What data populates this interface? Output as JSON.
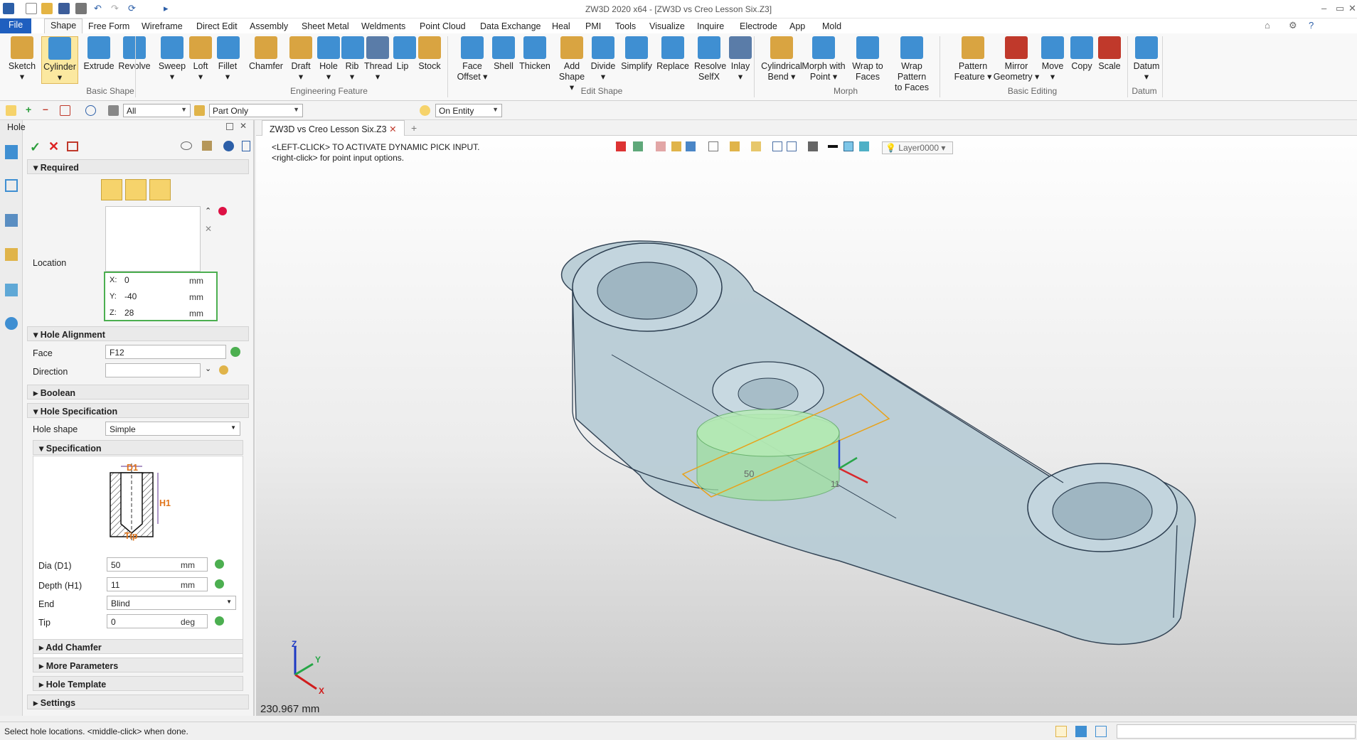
{
  "app": {
    "title": "ZW3D 2020 x64 - [ZW3D vs Creo Lesson Six.Z3]"
  },
  "menu": {
    "file": "File",
    "tabs": [
      "Shape",
      "Free Form",
      "Wireframe",
      "Direct Edit",
      "Assembly",
      "Sheet Metal",
      "Weldments",
      "Point Cloud",
      "Data Exchange",
      "Heal",
      "PMI",
      "Tools",
      "Visualize",
      "Inquire",
      "Electrode",
      "App",
      "Mold"
    ]
  },
  "ribbon": {
    "tools": [
      {
        "l1": "Sketch",
        "l2": "▾",
        "color": "#d9a441"
      },
      {
        "l1": "Cylinder",
        "l2": "▾",
        "color": "#3f8fd2"
      },
      {
        "l1": "Extrude",
        "l2": "",
        "color": "#3f8fd2"
      },
      {
        "l1": "Revolve",
        "l2": "",
        "color": "#3f8fd2"
      },
      {
        "l1": "Sweep",
        "l2": "▾",
        "color": "#3f8fd2"
      },
      {
        "l1": "Loft",
        "l2": "▾",
        "color": "#d9a441"
      },
      {
        "l1": "Fillet",
        "l2": "▾",
        "color": "#3f8fd2"
      },
      {
        "l1": "Chamfer",
        "l2": "",
        "color": "#d9a441"
      },
      {
        "l1": "Draft",
        "l2": "▾",
        "color": "#d9a441"
      },
      {
        "l1": "Hole",
        "l2": "▾",
        "color": "#3f8fd2"
      },
      {
        "l1": "Rib",
        "l2": "▾",
        "color": "#3f8fd2"
      },
      {
        "l1": "Thread",
        "l2": "▾",
        "color": "#5a7ca8"
      },
      {
        "l1": "Lip",
        "l2": "",
        "color": "#3f8fd2"
      },
      {
        "l1": "Stock",
        "l2": "",
        "color": "#d9a441"
      },
      {
        "l1": "Face",
        "l2": "Offset ▾",
        "color": "#3f8fd2"
      },
      {
        "l1": "Shell",
        "l2": "",
        "color": "#3f8fd2"
      },
      {
        "l1": "Thicken",
        "l2": "",
        "color": "#3f8fd2"
      },
      {
        "l1": "Add",
        "l2": "Shape ▾",
        "color": "#d9a441"
      },
      {
        "l1": "Divide",
        "l2": "▾",
        "color": "#3f8fd2"
      },
      {
        "l1": "Simplify",
        "l2": "",
        "color": "#3f8fd2"
      },
      {
        "l1": "Replace",
        "l2": "",
        "color": "#3f8fd2"
      },
      {
        "l1": "Resolve",
        "l2": "SelfX",
        "color": "#3f8fd2"
      },
      {
        "l1": "Inlay",
        "l2": "▾",
        "color": "#5a7ca8"
      },
      {
        "l1": "Cylindrical",
        "l2": "Bend ▾",
        "color": "#d9a441"
      },
      {
        "l1": "Morph with",
        "l2": "Point ▾",
        "color": "#3f8fd2"
      },
      {
        "l1": "Wrap to",
        "l2": "Faces",
        "color": "#3f8fd2"
      },
      {
        "l1": "Wrap Pattern",
        "l2": "to Faces",
        "color": "#3f8fd2"
      },
      {
        "l1": "Pattern",
        "l2": "Feature ▾",
        "color": "#d9a441"
      },
      {
        "l1": "Mirror",
        "l2": "Geometry ▾",
        "color": "#c0392b"
      },
      {
        "l1": "Move",
        "l2": "▾",
        "color": "#3f8fd2"
      },
      {
        "l1": "Copy",
        "l2": "",
        "color": "#3f8fd2"
      },
      {
        "l1": "Scale",
        "l2": "",
        "color": "#c0392b"
      },
      {
        "l1": "Datum",
        "l2": "▾",
        "color": "#3f8fd2"
      }
    ],
    "groups": [
      "Basic Shape",
      "Engineering Feature",
      "Edit Shape",
      "Morph",
      "Basic Editing",
      "Datum"
    ]
  },
  "toolbar": {
    "filter_value": "All",
    "scope_value": "Part Only",
    "pick_value": "On Entity"
  },
  "panel": {
    "title": "Hole",
    "required": "Required",
    "location_label": "Location",
    "x_label": "X:",
    "x_value": "0",
    "y_label": "Y:",
    "y_value": "-40",
    "z_label": "Z:",
    "z_value": "28",
    "unit_mm": "mm",
    "hole_alignment": "Hole Alignment",
    "face_label": "Face",
    "face_value": "F12",
    "direction_label": "Direction",
    "direction_value": "",
    "boolean": "Boolean",
    "hole_spec": "Hole Specification",
    "hole_shape_label": "Hole shape",
    "hole_shape_value": "Simple",
    "specification": "Specification",
    "diagram_d1": "D1",
    "diagram_h1": "H1",
    "diagram_tip": "Tip",
    "dia_label": "Dia (D1)",
    "dia_value": "50",
    "depth_label": "Depth (H1)",
    "depth_value": "11",
    "end_label": "End",
    "end_value": "Blind",
    "tip_label": "Tip",
    "tip_value": "0",
    "unit_deg": "deg",
    "add_chamfer": "Add Chamfer",
    "more_params": "More Parameters",
    "hole_template": "Hole Template",
    "settings": "Settings"
  },
  "viewport": {
    "doc_tab": "ZW3D vs Creo Lesson Six.Z3",
    "hint1": "<LEFT-CLICK> TO ACTIVATE DYNAMIC PICK INPUT.",
    "hint2": "<right-click> for point input options.",
    "layer": "Layer0000",
    "scale_text": "230.967 mm",
    "preview_dim1": "50",
    "preview_dim2": "11",
    "axis_x": "X",
    "axis_y": "Y",
    "axis_z": "Z"
  },
  "status": {
    "message": "Select hole locations. <middle-click> when done."
  },
  "colors": {
    "file_tab": "#1f5fbf",
    "part": "#b9cdd6",
    "preview": "#9fe0a0",
    "highlight": "#e8a21a"
  }
}
